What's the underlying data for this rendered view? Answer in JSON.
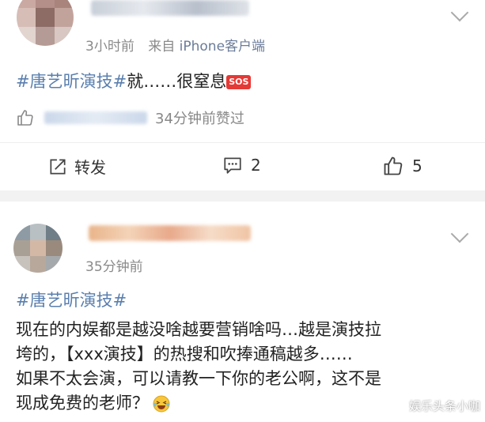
{
  "post1": {
    "time": "3小时前",
    "source_prefix": "来自",
    "device": "iPhone客户端",
    "hashtag": "#唐艺昕演技#",
    "text": "就……很窒息",
    "sos": "SOS",
    "like_text": "34分钟前赞过",
    "repost_label": "转发",
    "comment_count": "2",
    "like_count": "5"
  },
  "post2": {
    "time": "35分钟前",
    "hashtag": "#唐艺昕演技#",
    "lines": [
      "现在的内娱都是越没啥越要营销啥吗…越是演技拉",
      "垮的，【xxx演技】的热搜和吹捧通稿越多……",
      "如果不太会演，可以请教一下你的老公啊，这不是",
      "现成免费的老师？"
    ]
  },
  "watermark": "娱乐头条小咖"
}
